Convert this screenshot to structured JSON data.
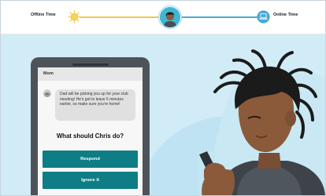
{
  "timeline": {
    "left_label": "Offline Time",
    "right_label": "Online Time",
    "icons": [
      "sun-icon",
      "character-avatar",
      "laptop-icon"
    ],
    "colors": {
      "offline_track": "#f2c84b",
      "online_track": "#46a9d6"
    }
  },
  "phone": {
    "contact_name": "Mom",
    "message": "Dad will be picking you up for your club meeting! He's got to leave 5 minutes earlier, so make sure you're home!",
    "question": "What should Chris do?",
    "options": [
      "Respond",
      "Ignore it"
    ],
    "colors": {
      "button": "#0e7d86"
    }
  }
}
